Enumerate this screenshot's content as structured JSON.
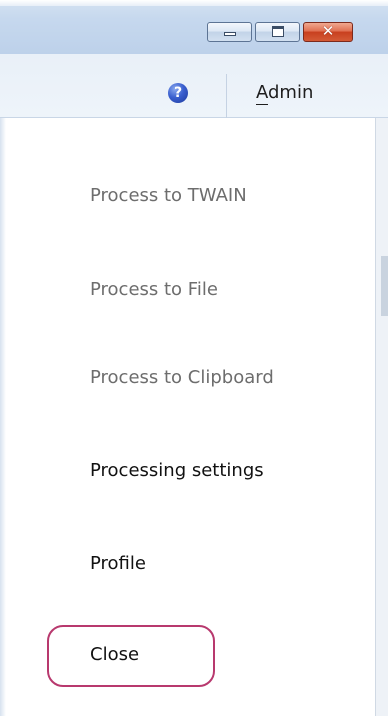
{
  "titlebar": {
    "buttons": [
      {
        "name": "minimize",
        "icon": "minimize-icon"
      },
      {
        "name": "maximize",
        "icon": "maximize-icon"
      },
      {
        "name": "close",
        "icon": "close-icon",
        "glyph": "✕"
      }
    ]
  },
  "header": {
    "help_icon": "help-icon",
    "help_glyph": "?",
    "admin_label": "Admin"
  },
  "menu": {
    "items": [
      {
        "label": "Process to TWAIN",
        "enabled": false
      },
      {
        "label": "Process to File",
        "enabled": false
      },
      {
        "label": "Process to Clipboard",
        "enabled": false
      },
      {
        "label": "Processing settings",
        "enabled": true
      },
      {
        "label": "Profile",
        "enabled": true
      },
      {
        "label": "Close",
        "enabled": true,
        "highlighted": true
      }
    ]
  },
  "colors": {
    "disabled_text": "#6d6d6d",
    "enabled_text": "#111111",
    "highlight_border": "#b8396e",
    "close_button": "#c8401f"
  }
}
